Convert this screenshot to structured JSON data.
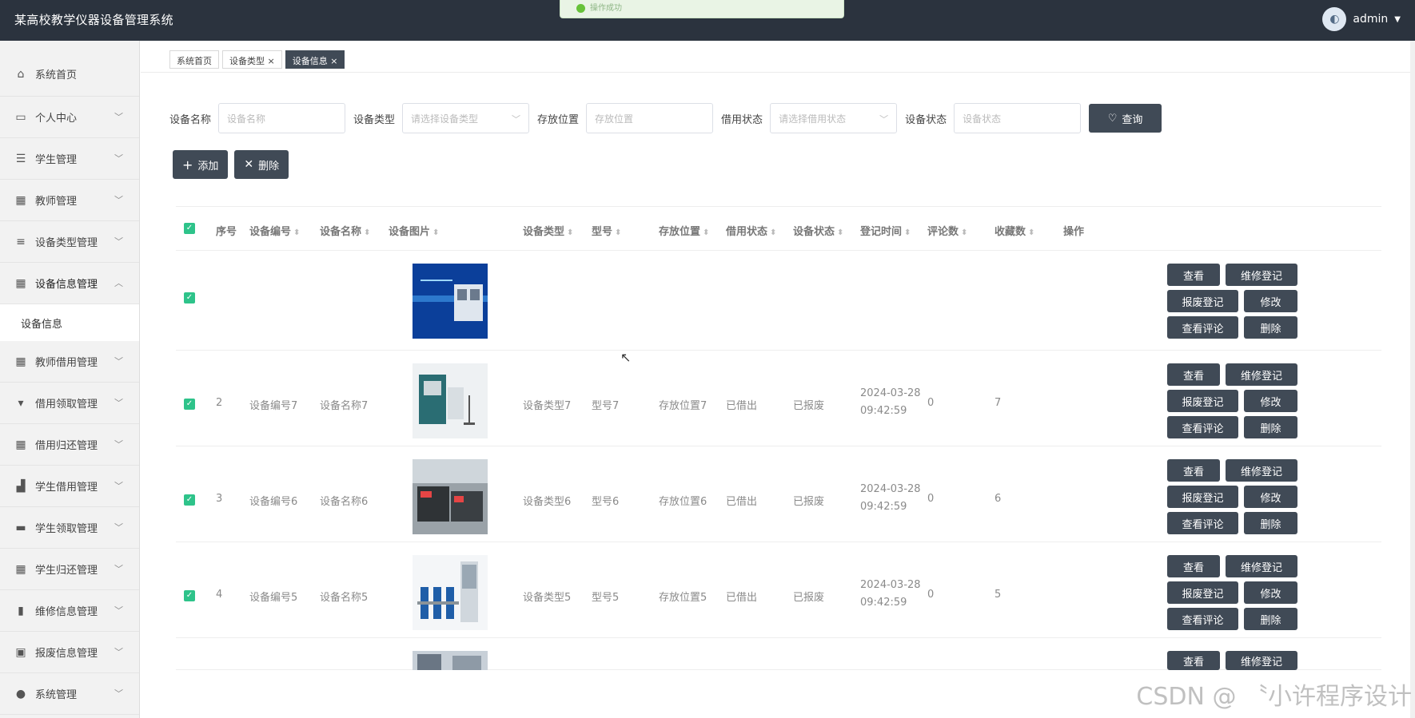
{
  "app": {
    "title": "某高校教学仪器设备管理系统",
    "user": "admin",
    "toast": "操作成功"
  },
  "tabs": [
    {
      "label": "系统首页"
    },
    {
      "label": "设备类型 ×"
    },
    {
      "label": "设备信息 ×",
      "active": true
    }
  ],
  "sidebar": {
    "items": [
      {
        "label": "系统首页",
        "icon": "home-icon"
      },
      {
        "label": "个人中心",
        "icon": "card-icon"
      },
      {
        "label": "学生管理",
        "icon": "list-icon"
      },
      {
        "label": "教师管理",
        "icon": "grid-icon"
      },
      {
        "label": "设备类型管理",
        "icon": "sliders-icon"
      },
      {
        "label": "设备信息管理",
        "icon": "grid-icon",
        "open": true,
        "sub": "设备信息"
      },
      {
        "label": "教师借用管理",
        "icon": "grid-icon"
      },
      {
        "label": "借用领取管理",
        "icon": "stamp-icon"
      },
      {
        "label": "借用归还管理",
        "icon": "grid-icon"
      },
      {
        "label": "学生借用管理",
        "icon": "chart-icon"
      },
      {
        "label": "学生领取管理",
        "icon": "monitor-icon"
      },
      {
        "label": "学生归还管理",
        "icon": "grid-icon"
      },
      {
        "label": "维修信息管理",
        "icon": "bars-icon"
      },
      {
        "label": "报废信息管理",
        "icon": "clipboard-icon"
      },
      {
        "label": "系统管理",
        "icon": "user-icon"
      }
    ]
  },
  "search": {
    "name_label": "设备名称",
    "name_placeholder": "设备名称",
    "type_label": "设备类型",
    "type_placeholder": "请选择设备类型",
    "loc_label": "存放位置",
    "loc_placeholder": "存放位置",
    "borrow_label": "借用状态",
    "borrow_placeholder": "请选择借用状态",
    "status_label": "设备状态",
    "status_placeholder": "设备状态",
    "query_label": "查询"
  },
  "actions": {
    "add_label": "添加",
    "delete_label": "删除"
  },
  "table": {
    "headers": {
      "index": "序号",
      "code": "设备编号",
      "name": "设备名称",
      "image": "设备图片",
      "type": "设备类型",
      "model": "型号",
      "location": "存放位置",
      "borrow": "借用状态",
      "status": "设备状态",
      "time": "登记时间",
      "comments": "评论数",
      "favorites": "收藏数",
      "ops": "操作"
    },
    "ops": {
      "view": "查看",
      "repair": "维修登记",
      "scrap": "报废登记",
      "edit": "修改",
      "comments": "查看评论",
      "delete": "删除"
    },
    "rows": [
      {
        "index": "",
        "code": "",
        "name": "",
        "type": "",
        "model": "",
        "location": "",
        "borrow": "",
        "status": "",
        "date": "",
        "clock": "",
        "comments": "",
        "favorites": "",
        "thumb": "blue"
      },
      {
        "index": "2",
        "code": "设备编号7",
        "name": "设备名称7",
        "type": "设备类型7",
        "model": "型号7",
        "location": "存放位置7",
        "borrow": "已借出",
        "status": "已报废",
        "date": "2024-03-28",
        "clock": "09:42:59",
        "comments": "0",
        "favorites": "7",
        "thumb": "white"
      },
      {
        "index": "3",
        "code": "设备编号6",
        "name": "设备名称6",
        "type": "设备类型6",
        "model": "型号6",
        "location": "存放位置6",
        "borrow": "已借出",
        "status": "已报废",
        "date": "2024-03-28",
        "clock": "09:42:59",
        "comments": "0",
        "favorites": "6",
        "thumb": "factory"
      },
      {
        "index": "4",
        "code": "设备编号5",
        "name": "设备名称5",
        "type": "设备类型5",
        "model": "型号5",
        "location": "存放位置5",
        "borrow": "已借出",
        "status": "已报废",
        "date": "2024-03-28",
        "clock": "09:42:59",
        "comments": "0",
        "favorites": "5",
        "thumb": "pumps"
      }
    ]
  },
  "watermark": "CSDN @ 〝小许程序设计"
}
